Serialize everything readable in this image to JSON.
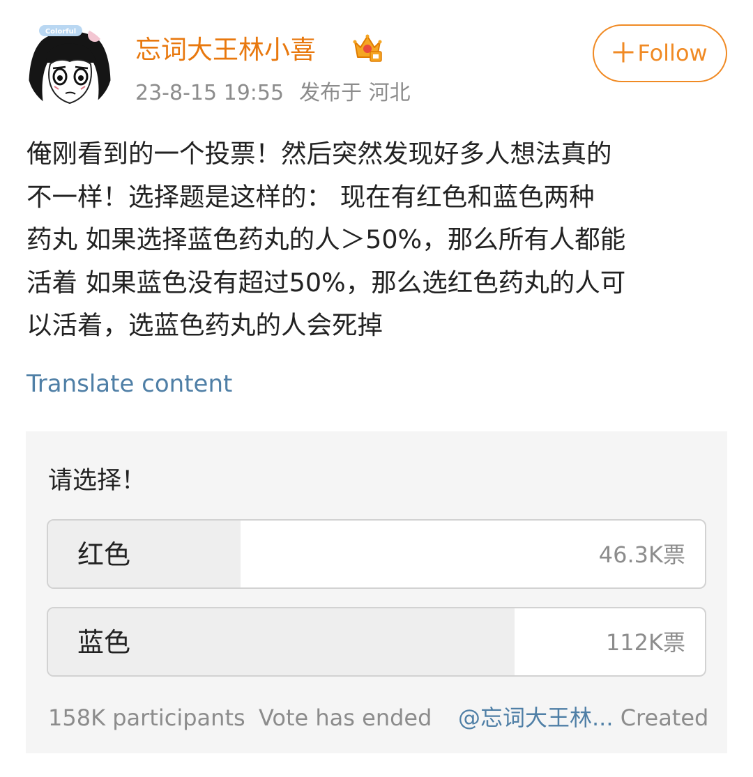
{
  "colors": {
    "brand_orange": "#e8780e",
    "follow_orange": "#f08a24",
    "link_blue": "#4f7fa6",
    "secondary_text": "#8c8c8c",
    "poll_bg": "#f5f5f5",
    "poll_fill": "#eeeeee"
  },
  "post": {
    "author": {
      "name": "忘词大王林小喜",
      "avatar_icon": "manga-girl-avatar-icon",
      "avatar_badge": "Colorful",
      "vip_icon": "crown-vip-icon"
    },
    "timestamp": "23-8-15 19:55",
    "location": "发布于 河北",
    "follow_button": {
      "icon": "plus-icon",
      "label": "Follow"
    },
    "body": "俺刚看到的一个投票！然后突然发现好多人想法真的\n不一样！选择题是这样的：  现在有红色和蓝色两种\n药丸 如果选择蓝色药丸的人＞50%，那么所有人都能\n活着 如果蓝色没有超过50%，那么选红色药丸的人可\n以活着，选蓝色药丸的人会死掉",
    "translate_label": "Translate content"
  },
  "poll": {
    "question": "请选择！",
    "options": [
      {
        "label": "红色",
        "votes": "46.3K票",
        "share": 0.293
      },
      {
        "label": "蓝色",
        "votes": "112K票",
        "share": 0.71
      }
    ],
    "participants": "158K participants",
    "status": "Vote has ended",
    "creator_handle": "@忘词大王林...",
    "creator_suffix": "Created"
  }
}
